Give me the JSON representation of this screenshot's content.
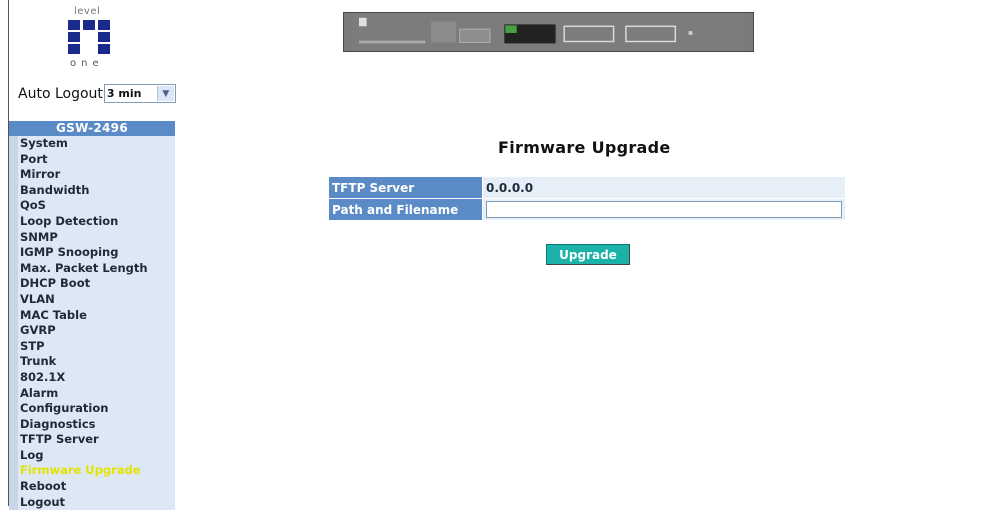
{
  "logo": {
    "top_text": "level",
    "bottom_text": "one"
  },
  "auto_logout": {
    "label": "Auto Logout",
    "selected": "3 min"
  },
  "sidebar": {
    "title": "GSW-2496",
    "items": [
      {
        "label": "System"
      },
      {
        "label": "Port"
      },
      {
        "label": "Mirror"
      },
      {
        "label": "Bandwidth"
      },
      {
        "label": "QoS"
      },
      {
        "label": "Loop Detection"
      },
      {
        "label": "SNMP"
      },
      {
        "label": "IGMP Snooping"
      },
      {
        "label": "Max. Packet Length"
      },
      {
        "label": "DHCP Boot"
      },
      {
        "label": "VLAN"
      },
      {
        "label": "MAC Table"
      },
      {
        "label": "GVRP"
      },
      {
        "label": "STP"
      },
      {
        "label": "Trunk"
      },
      {
        "label": "802.1X"
      },
      {
        "label": "Alarm"
      },
      {
        "label": "Configuration"
      },
      {
        "label": "Diagnostics"
      },
      {
        "label": "TFTP Server"
      },
      {
        "label": "Log"
      },
      {
        "label": "Firmware Upgrade",
        "active": true
      },
      {
        "label": "Reboot"
      },
      {
        "label": "Logout"
      }
    ]
  },
  "main": {
    "title": "Firmware Upgrade",
    "rows": [
      {
        "label": "TFTP Server",
        "value": "0.0.0.0"
      },
      {
        "label": "Path and Filename",
        "value": ""
      }
    ],
    "upgrade_label": "Upgrade"
  },
  "colors": {
    "header_blue": "#5b8bc6",
    "menu_bg": "#dde8f4",
    "active_yellow": "#e3e300",
    "button_teal": "#1ab2a9"
  }
}
